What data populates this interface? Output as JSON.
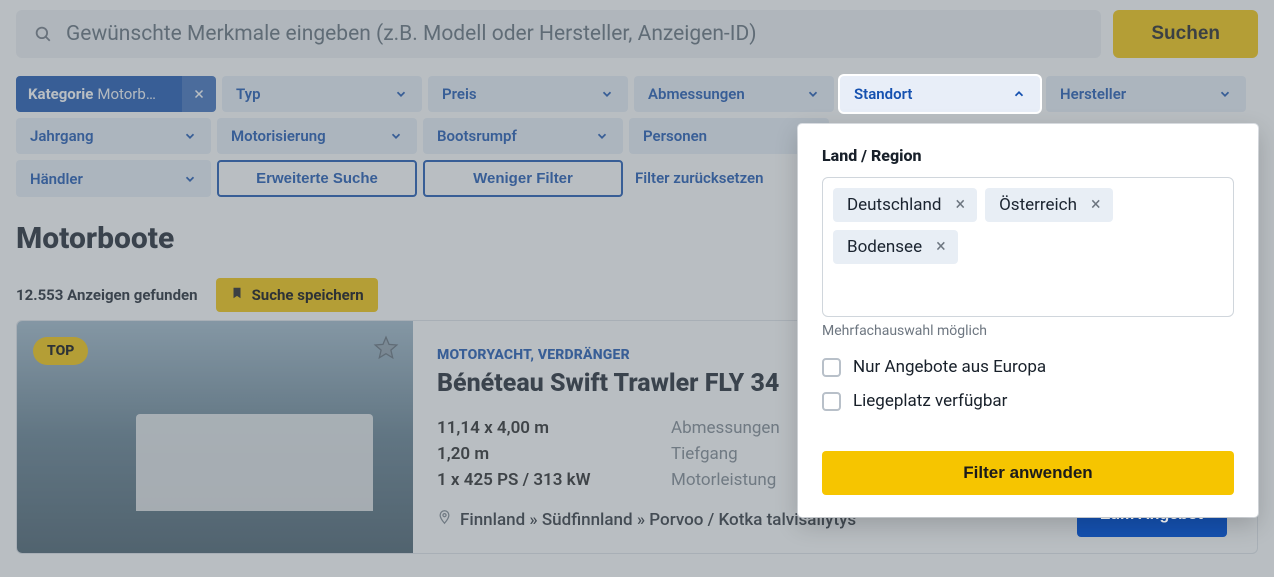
{
  "search": {
    "placeholder": "Gewünschte Merkmale eingeben (z.B. Modell oder Hersteller, Anzeigen-ID)",
    "button": "Suchen"
  },
  "filters": {
    "category_label": "Kategorie",
    "category_value": "Motorb…",
    "type": "Typ",
    "price": "Preis",
    "dimensions": "Abmessungen",
    "location": "Standort",
    "manufacturer": "Hersteller",
    "year": "Jahrgang",
    "engine": "Motorisierung",
    "hull": "Bootsrumpf",
    "persons": "Personen",
    "dealer": "Händler",
    "advanced": "Erweiterte Suche",
    "less": "Weniger Filter",
    "reset": "Filter zurücksetzen"
  },
  "results": {
    "heading": "Motorboote",
    "count": "12.553 Anzeigen gefunden",
    "save": "Suche speichern"
  },
  "listing": {
    "top_badge": "TOP",
    "kicker": "MOTORYACHT, VERDRÄNGER",
    "title": "Bénéteau Swift Trawler FLY 34",
    "dim_val": "11,14 x 4,00 m",
    "dim_lab": "Abmessungen",
    "draft_val": "1,20 m",
    "draft_lab": "Tiefgang",
    "power_val": "1 x 425 PS / 313 kW",
    "power_lab": "Motorleistung",
    "location": "Finnland » Südfinnland » Porvoo / Kotka talvisäilytys",
    "offer": "Zum Angebot"
  },
  "popup": {
    "heading": "Land / Region",
    "tags": [
      "Deutschland",
      "Österreich",
      "Bodensee"
    ],
    "hint": "Mehrfachauswahl möglich",
    "cb1": "Nur Angebote aus Europa",
    "cb2": "Liegeplatz verfügbar",
    "apply": "Filter anwenden"
  }
}
